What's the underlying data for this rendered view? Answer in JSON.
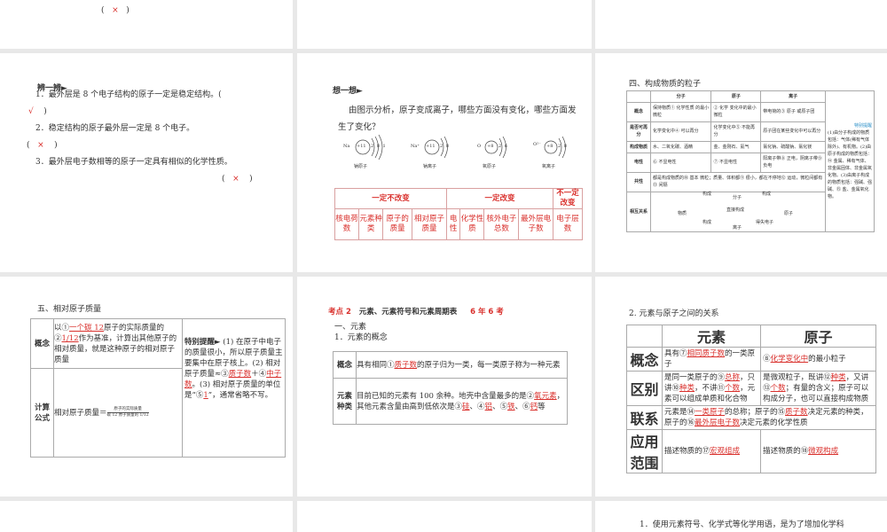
{
  "slide1": {
    "open": "(",
    "mark": "×",
    "close": ")"
  },
  "slide2": {
    "heading": "辨一辨",
    "items": [
      {
        "text": "1．最外层是 8 个电子结构的原子一定是稳定结构。(",
        "mark": "√",
        "close": ")"
      },
      {
        "text": "2．稳定结构的原子最外层一定是 8 个电子。",
        "open": "(",
        "mark": "×",
        "close": ")"
      },
      {
        "text": "3．最外层电子数相等的原子一定具有相似的化学性质。",
        "open": "(",
        "mark": "×",
        "close": ")"
      }
    ]
  },
  "slide3": {
    "heading": "想一想",
    "question": "由图示分析，原子变成离子，哪些方面没有变化，哪些方面发生了变化？",
    "atoms": [
      {
        "symbol": "Na",
        "nucleus": "+11",
        "shells": "2 8 1",
        "label": "钠原子"
      },
      {
        "symbol": "Na⁺",
        "nucleus": "+11",
        "shells": "2 8",
        "label": "钠离子"
      },
      {
        "symbol": "O",
        "nucleus": "+8",
        "shells": "2 6",
        "label": "氧原子"
      },
      {
        "symbol": "O²⁻",
        "nucleus": "+8",
        "shells": "2 8",
        "label": "氧离子"
      }
    ],
    "table": {
      "groups": [
        "一定不改变",
        "一定改变",
        "不一定改变"
      ],
      "cells": [
        "核电荷数",
        "元素种类",
        "原子的质量",
        "相对原子质量",
        "电性",
        "化学性质",
        "核外电子总数",
        "最外层电子数",
        "电子层数"
      ]
    }
  },
  "slide4": {
    "heading": "四、构成物质的粒子",
    "headers": [
      "分子",
      "原子",
      "离子"
    ],
    "rows": [
      {
        "label": "概念",
        "cells": [
          "保持物质① 化学性质 的最小微粒",
          "② 化学 变化中的最小微粒",
          "带电荷的③ 原子 或原子团"
        ]
      },
      {
        "label": "是否可再分",
        "cells": [
          "化学变化中④ 可以再分",
          "化学变化中⑤ 不能再分",
          "原子团在某些变化中可以再分"
        ]
      },
      {
        "label": "构成物质",
        "cells": [
          "水、二氧化碳、酒精",
          "金、金刚石、氦气",
          "氯化钠、硫酸钠、氯化镁"
        ]
      },
      {
        "label": "电性",
        "cells": [
          "⑥ 不显电性",
          "⑦ 不显电性",
          "阳离子带⑧ 正电，阴离子带⑨ 负电"
        ]
      },
      {
        "label": "共性",
        "cells": [
          "都是构成物质的⑩ 基本 微粒；质量、体积都⑪ 很小，都在不停地⑫ 运动，微粒间都有⑬ 间隔"
        ]
      },
      {
        "label": "相互关系",
        "cells": [
          "分子",
          "原子",
          "离子",
          "物质",
          "构成",
          "构成",
          "直接构成",
          "构成",
          "得失电子"
        ]
      }
    ],
    "note": {
      "title": "特别提醒",
      "text": "(1)由分子构成的物质包括：气体(稀有气体除外)、有机物。(2)由原子构成的物质包括：⑭ 金属、稀有气体、非金属固体、非金属氧化物。(3)由离子构成的物质包括：强碱、强碱、⑮ 盐、金属氧化物。"
    }
  },
  "slide5": {
    "heading": "五、相对原子质量",
    "concept_label": "概念",
    "concept": [
      "以①",
      "一个碳 12",
      "原子的实际质量的②",
      "1/12",
      "作为基准，计算出其他原子的相对质量，就是这种原子的相对原子质量"
    ],
    "formula_label": "计算公式",
    "formula_lhs": "相对原子质量＝",
    "numerator": "原子的实际质量",
    "denominator": "碳 12 原子质量的 1/12",
    "note_title": "特别提醒",
    "note": [
      "(1) 在原子中电子的质量很小，所以原子质量主要集中在原子核上。(2) 相对原子质量≈③",
      "质子数",
      "＋④",
      "中子数",
      "。(3) 相对原子质量的单位是“⑤",
      "1",
      "”，通常省略不写。"
    ]
  },
  "slide6": {
    "kaodian": "考点 2",
    "title": "元素、元素符号和元素周期表",
    "freq": "6 年 6 考",
    "sec1": "一、元素",
    "sub1": "1．元素的概念",
    "rows": [
      {
        "label": "概念",
        "parts": [
          "具有相同①",
          "质子数",
          "的原子归为一类，每一类原子称为一种元素"
        ]
      },
      {
        "label": "元素种类",
        "parts": [
          "目前已知的元素有 100 余种。地壳中含量最多的是②",
          "氧元素",
          "，其他元素含量由高到低依次是③",
          "硅",
          "、④",
          "铝",
          "、⑤",
          "铁",
          "、⑥",
          "钙",
          "等"
        ]
      }
    ]
  },
  "slide7": {
    "heading": "2. 元素与原子之间的关系",
    "headers": [
      "元素",
      "原子"
    ],
    "rows": [
      {
        "label": "概念",
        "a": [
          "具有⑦",
          "相同质子数",
          "的一类原子"
        ],
        "b": [
          "⑧",
          "化学变化中",
          "的最小粒子"
        ]
      },
      {
        "label": "区别",
        "a": [
          "是同一类原子的⑨",
          "总称",
          "，只讲⑩",
          "种类",
          "，不讲⑪",
          "个数",
          "，元素可以组成单质和化合物"
        ],
        "b": [
          "是微观粒子，既讲⑫",
          "种类",
          "，又讲⑬",
          "个数",
          "；有量的含义；原子可以构成分子，也可以直接构成物质"
        ]
      },
      {
        "label": "联系",
        "a": [
          "元素是⑭",
          "一类原子",
          "的总称；原子的⑮",
          "质子数",
          "决定元素的种类，原子的⑯",
          "最外层电子数",
          "决定元素的化学性质"
        ]
      },
      {
        "label": "应用范围",
        "a": [
          "描述物质的⑰",
          "宏观组成"
        ],
        "b": [
          "描述物质的⑱",
          "微观构成"
        ]
      }
    ]
  },
  "slide10": {
    "text": "1．使用元素符号、化学式等化学用语，是为了增加化学科"
  }
}
